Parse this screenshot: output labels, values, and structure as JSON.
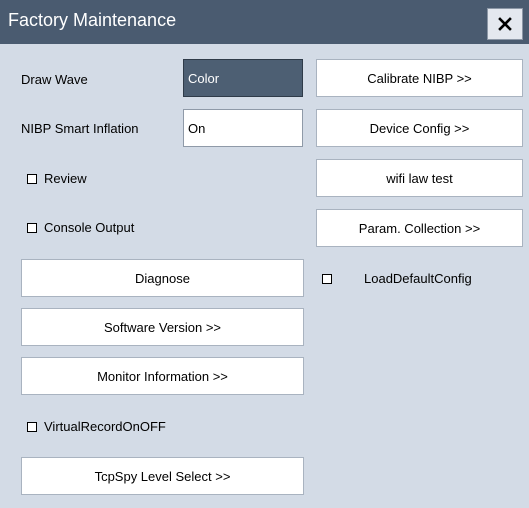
{
  "window": {
    "title": "Factory Maintenance",
    "close_icon": "close-icon"
  },
  "left": {
    "draw_wave": {
      "label": "Draw Wave",
      "value": "Color"
    },
    "nibp_smart_inflation": {
      "label": "NIBP Smart Inflation",
      "value": "On"
    },
    "review": {
      "label": "Review",
      "checked": false
    },
    "console_output": {
      "label": "Console Output",
      "checked": false
    },
    "diagnose": "Diagnose",
    "software_version": "Software Version >>",
    "monitor_information": "Monitor Information >>",
    "virtual_record": {
      "label": "VirtualRecordOnOFF",
      "checked": false
    },
    "tcpspy_level_select": "TcpSpy Level Select >>"
  },
  "right": {
    "calibrate_nibp": "Calibrate NIBP >>",
    "device_config": "Device Config >>",
    "wifi_law_test": "wifi law test",
    "param_collection": "Param. Collection >>",
    "load_default_config": {
      "label": "LoadDefaultConfig",
      "checked": false
    }
  },
  "colors": {
    "titlebar": "#4a5b70",
    "panel": "#d3dbe6",
    "selected_field": "#4d5f73"
  }
}
